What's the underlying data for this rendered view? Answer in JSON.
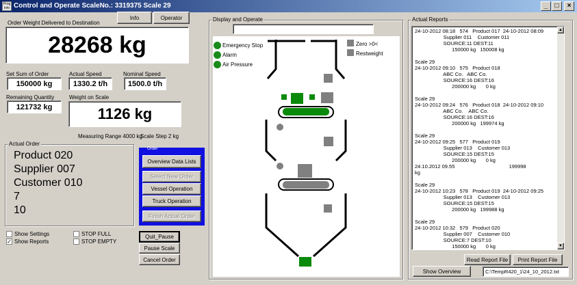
{
  "window": {
    "title": "Control and Operate ScaleNo.: 3319375  Scale 29",
    "app_icon_text": "Prog\nInfo",
    "minimize": "_",
    "maximize": "□",
    "close": "×"
  },
  "header_buttons": {
    "info": "Info",
    "operator": "Operator"
  },
  "order_weight": {
    "label": "Order Weight Delivered to Destination",
    "value": "28268 kg"
  },
  "fields": {
    "set_sum_label": "Set Sum of Order",
    "set_sum_value": "150000 kg",
    "actual_speed_label": "Actual Speed",
    "actual_speed_value": "1330.2 t/h",
    "nominal_speed_label": "Nominal Speed",
    "nominal_speed_value": "1500.0 t/h",
    "remaining_label": "Remaining Quantity",
    "remaining_value": "121732 kg",
    "weight_on_scale_label": "Weight on Scale",
    "weight_on_scale_value": "1126 kg",
    "measuring_range": "Measuring Range  4000 kg",
    "scale_step": "Scale Step 2 kg"
  },
  "actual_order": {
    "label": "Actual Order",
    "lines": [
      "Product 020",
      "Supplier 007",
      "Customer 010",
      "7",
      "10"
    ]
  },
  "order_buttons": {
    "group_label": "Order",
    "overview": "Overview Data Lists",
    "select_new": "Select New Order",
    "vessel": "Vessel Operation",
    "truck": "Truck Operation",
    "finish": "Finish Actual Order"
  },
  "checkboxes": {
    "show_settings": "Show Settings",
    "show_reports": "Show Reports",
    "stop_full": "STOP FULL",
    "stop_empty": "STOP EMPTY",
    "show_settings_checked": "",
    "show_reports_checked": "✓"
  },
  "bottom_buttons": {
    "quit_pause": "Quit_Pause",
    "pause_scale": "Pause Scale",
    "cancel_order": "Cancel Order"
  },
  "display": {
    "label": "Display and Operate",
    "emergency_stop": "Emergency Stop",
    "alarm": "Alarm",
    "air_pressure": "Air Pressure",
    "zero": "Zero >0<",
    "restweight": "Restweight",
    "colors": {
      "green": "#0a8a0a",
      "gray": "#808080"
    }
  },
  "reports": {
    "label": "Actual Reports",
    "text": "24-10-2012 08:18   574   Product 017  24-10-2012 08:09\n                    Supplier 011    Customer 011\n                    SOURCE:11 DEST:11\n                          150000 kg   150008 kg\n\nScale 29\n24-10-2012 09:10   575   Product 018\n                    ABC Co.   ABC Co.\n                    SOURCE:16 DEST:16\n                          200000 kg       0 kg\n\nScale 29\n24-10-2012 09:24   576   Product 018  24-10-2012 09:10\n                    ABC Co.    ABC Co.\n                    SOURCE:16 DEST:16\n                          200000 kg   199974 kg\n\nScale 29\n24-10-2012 09:25   577   Product 019\n                    Supplier 013    Customer 013\n                    SOURCE:15 DEST:15\n                          200000 kg       0 kg\n24.10.2012 09.55                                      199998\nkg\n\nScale 29\n24-10-2012 10:23   578   Product 019  24-10-2012 09:25\n                    Supplier 013    Customer 013\n                    SOURCE:15 DEST:15\n                          200000 kg   199988 kg\n\nScale 29\n24-10-2012 10:32   579   Product 020\n                    Supplier 007    Customer 010\n                    SOURCE:7 DEST:10\n                          150000 kg       0 kg",
    "read_file": "Read Report File",
    "print_file": "Print Report File",
    "show_overview": "Show Overview",
    "file_path": "C:\\TempR420_1\\24_10_2012.txt"
  }
}
